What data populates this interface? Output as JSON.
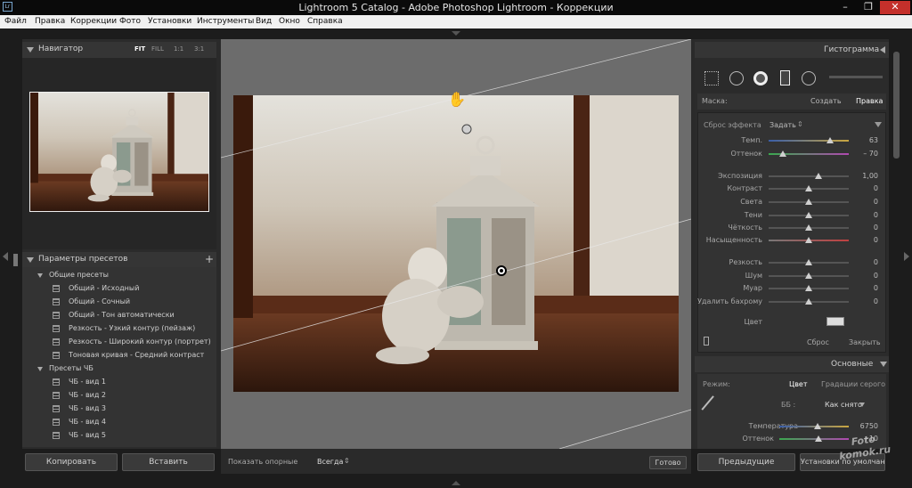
{
  "window": {
    "title": "Lightroom 5 Catalog - Adobe Photoshop Lightroom - Коррекции",
    "app_icon": "Lr"
  },
  "menu": [
    "Файл",
    "Правка",
    "Коррекции",
    "Фото",
    "Установки",
    "Инструменты",
    "Вид",
    "Окно",
    "Справка"
  ],
  "navigator": {
    "title": "Навигатор",
    "zoom": [
      "FIT",
      "FILL",
      "1:1",
      "3:1"
    ]
  },
  "presets": {
    "title": "Параметры пресетов",
    "add": "+",
    "folders": [
      {
        "name": "Общие пресеты",
        "items": [
          "Общий - Исходный",
          "Общий - Сочный",
          "Общий - Тон автоматически",
          "Резкость - Узкий контур (пейзаж)",
          "Резкость - Широкий контур (портрет)",
          "Тоновая кривая - Средний контраст"
        ]
      },
      {
        "name": "Пресеты ЧБ",
        "items": [
          "ЧБ - вид 1",
          "ЧБ - вид 2",
          "ЧБ - вид 3",
          "ЧБ - вид 4",
          "ЧБ - вид 5"
        ]
      }
    ]
  },
  "left_buttons": {
    "copy": "Копировать",
    "paste": "Вставить"
  },
  "toolbar": {
    "show_overlay": "Показать опорные",
    "overlay_value": "Всегда",
    "done": "Готово"
  },
  "histogram": {
    "title": "Гистограмма"
  },
  "mask": {
    "label": "Маска:",
    "create": "Создать",
    "edit": "Правка"
  },
  "effect": {
    "label": "Сброс эффекта",
    "preset": "Задать"
  },
  "adjust": [
    {
      "label": "Темп.",
      "value": "63",
      "pos": 0.77
    },
    {
      "label": "Оттенок",
      "value": "– 70",
      "pos": 0.18
    },
    {
      "label": "Экспозиция",
      "value": "1,00",
      "pos": 0.62
    },
    {
      "label": "Контраст",
      "value": "0",
      "pos": 0.5
    },
    {
      "label": "Света",
      "value": "0",
      "pos": 0.5
    },
    {
      "label": "Тени",
      "value": "0",
      "pos": 0.5
    },
    {
      "label": "Чёткость",
      "value": "0",
      "pos": 0.5
    },
    {
      "label": "Насыщенность",
      "value": "0",
      "pos": 0.5
    },
    {
      "label": "Резкость",
      "value": "0",
      "pos": 0.5
    },
    {
      "label": "Шум",
      "value": "0",
      "pos": 0.5
    },
    {
      "label": "Муар",
      "value": "0",
      "pos": 0.5
    },
    {
      "label": "Удалить бахрому",
      "value": "0",
      "pos": 0.5
    }
  ],
  "color_label": "Цвет",
  "reset": "Сброс",
  "close": "Закрыть",
  "basic": {
    "title": "Основные",
    "mode": "Режим:",
    "color": "Цвет",
    "gray": "Градации серого",
    "wb_label": "ББ :",
    "wb_value": "Как снято",
    "temp_label": "Температура",
    "temp_value": "6750",
    "temp_pos": 0.55,
    "tint_label": "Оттенок",
    "tint_value": "+10",
    "tint_pos": 0.57
  },
  "right_buttons": {
    "previous": "Предыдущие",
    "defaults": "Установки по умолчанию"
  },
  "watermark": {
    "line1": "Foto",
    "line2": "komok.ru"
  }
}
